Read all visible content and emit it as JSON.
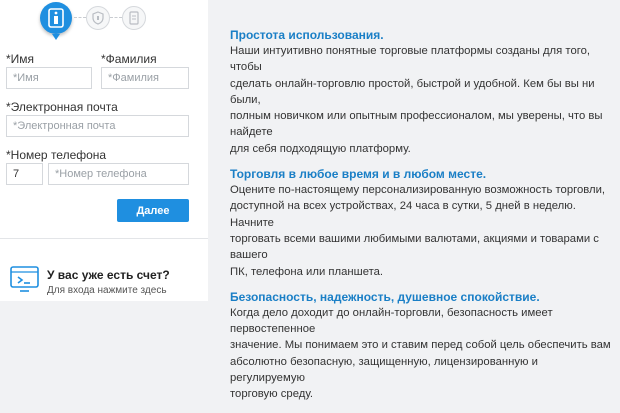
{
  "form": {
    "first_name_label": "*Имя",
    "first_name_placeholder": "*Имя",
    "last_name_label": "*Фамилия",
    "last_name_placeholder": "*Фамилия",
    "email_label": "*Электронная почта",
    "email_placeholder": "*Электронная почта",
    "phone_label": "*Номер телефона",
    "phone_code_value": "7",
    "phone_placeholder": "*Номер телефона",
    "submit_label": "Далее"
  },
  "login": {
    "title": "У вас уже есть счет?",
    "subtitle": "Для входа нажмите здесь"
  },
  "features": [
    {
      "title": "Простота использования.",
      "lines": [
        "Наши интуитивно понятные торговые платформы созданы для того, чтобы",
        "сделать онлайн-торговлю простой, быстрой и удобной. Кем бы вы ни были,",
        "полным новичком или опытным профессионалом, мы уверены, что вы найдете",
        "для себя подходящую платформу."
      ]
    },
    {
      "title": "Торговля в любое время и в любом месте.",
      "lines": [
        "Оцените по-настоящему персонализированную возможность торговли,",
        "доступной на всех устройствах, 24 часа в сутки, 5 дней в неделю. Начните",
        "торговать всеми вашими любимыми валютами, акциями и товарами с вашего",
        "ПК, телефона или планшета."
      ]
    },
    {
      "title": "Безопасность, надежность, душевное спокойствие.",
      "lines": [
        "Когда дело доходит до онлайн-торговли, безопасность имеет первостепенное",
        "значение. Мы понимаем это и ставим перед собой цель обеспечить вам",
        "абсолютно безопасную, защищенную, лицензированную и регулируемую",
        "торговую среду."
      ]
    }
  ],
  "colors": {
    "accent": "#1f8fe0",
    "heading": "#1a7fc6",
    "background": "#f1f2f4"
  },
  "icons": {
    "step_1": "id-card-icon",
    "step_2": "shield-icon",
    "step_3": "document-icon",
    "login": "computer-login-icon"
  }
}
